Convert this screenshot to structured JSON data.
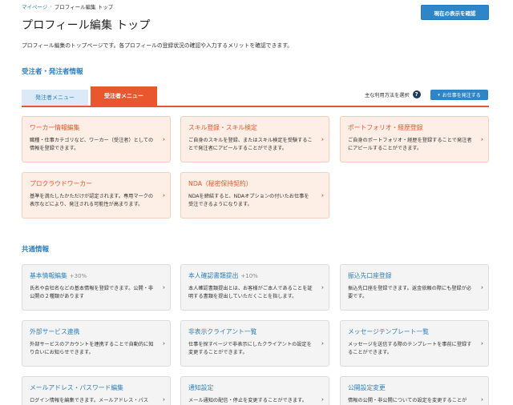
{
  "breadcrumb": {
    "home": "マイページ",
    "current": "プロフィール編集 トップ"
  },
  "confirm_button": "現在の表示を確認",
  "page_title": "プロフィール編集 トップ",
  "page_desc": "プロフィール編集のトップページです。各プロフィールの登録状況の確認や入力するメリットを確認できます。",
  "section1": {
    "title": "受注者・発注者情報",
    "tabs": [
      {
        "label": "発注者メニュー"
      },
      {
        "label": "受注者メニュー"
      }
    ],
    "usage_label": "主な利用方法を選択",
    "order_button": "お仕事を発注する",
    "cards": [
      {
        "title": "ワーカー情報編集",
        "desc": "職種・仕事カテゴリなど、ワーカー（受注者）としての情報を登録できます。"
      },
      {
        "title": "スキル登録・スキル検定",
        "desc": "ご自身のスキルを登録、またはスキル検定を受験することで発注者にアピールすることができます。"
      },
      {
        "title": "ポートフォリオ・経歴登録",
        "desc": "ご自身のポートフォリオ・経歴を登録することで発注者にアピールすることができます。"
      },
      {
        "title": "プロクラウドワーカー",
        "desc": "基準を満たしたかただけが認定されます。専用マークの表示などにより、発注される可能性が高まります。"
      },
      {
        "title": "NDA（秘密保持契約）",
        "desc": "NDAを締結すると、NDAオプションの付いたお仕事を受注できるようになります。"
      }
    ]
  },
  "section2": {
    "title": "共通情報",
    "cards": [
      {
        "title": "基本情報編集",
        "pct": "+30%",
        "desc": "氏名や会社名などの基本情報を登録できます。公開・非公開の２種類があります"
      },
      {
        "title": "本人確認書類提出",
        "pct": "+10%",
        "desc": "本人確認書類提出とは、お客様がご本人であることを証明する書類を提出していただくことを指します。"
      },
      {
        "title": "振込先口座登録",
        "pct": "",
        "desc": "振込先口座を登録できます。返金依頼の際にも登録が必要です。"
      },
      {
        "title": "外部サービス連携",
        "pct": "",
        "desc": "外部サービスのアカウントを連携することで自動的に知り合いにお知らせできます。"
      },
      {
        "title": "非表示クライアント一覧",
        "pct": "",
        "desc": "仕事を探すページで非表示にしたクライアントの設定を変更することができます。"
      },
      {
        "title": "メッセージテンプレート一覧",
        "pct": "",
        "desc": "メッセージを送信する際のテンプレートを事前に登録することができます。"
      },
      {
        "title": "メールアドレス・パスワード編集",
        "pct": "",
        "desc": "ログイン情報を編集できます。メールアドレス・パス"
      },
      {
        "title": "通知設定",
        "pct": "",
        "desc": "メール通知の配信・停止を変更することができます。"
      },
      {
        "title": "公開設定変更",
        "pct": "",
        "desc": "情報の公開・非公開についての設定を変更することが"
      }
    ]
  }
}
